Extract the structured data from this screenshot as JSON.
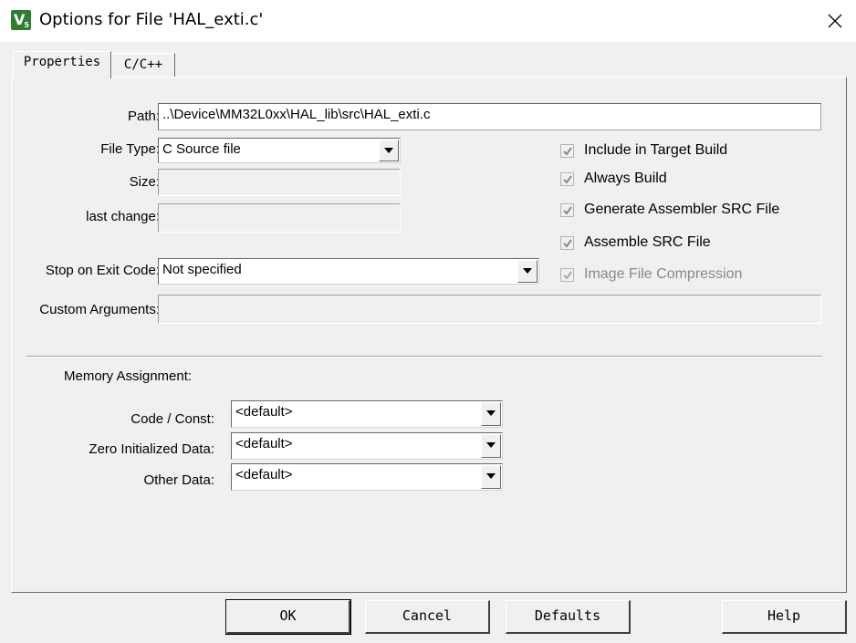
{
  "window": {
    "title": "Options for File 'HAL_exti.c'"
  },
  "tabs": [
    {
      "label": "Properties"
    },
    {
      "label": "C/C++"
    }
  ],
  "fields": {
    "path": {
      "label": "Path:",
      "value": "..\\Device\\MM32L0xx\\HAL_lib\\src\\HAL_exti.c"
    },
    "file_type": {
      "label": "File Type:",
      "value": "C Source file"
    },
    "size": {
      "label": "Size:",
      "value": ""
    },
    "last_change": {
      "label": "last change:",
      "value": ""
    },
    "stop_on_exit": {
      "label": "Stop on Exit Code:",
      "value": "Not specified"
    },
    "custom_args": {
      "label": "Custom Arguments:",
      "value": ""
    }
  },
  "checkboxes": [
    {
      "label": "Include in Target Build",
      "checked": true,
      "enabled": true
    },
    {
      "label": "Always Build",
      "checked": true,
      "enabled": true
    },
    {
      "label": "Generate Assembler SRC File",
      "checked": true,
      "enabled": true
    },
    {
      "label": "Assemble SRC File",
      "checked": true,
      "enabled": true
    },
    {
      "label": "Image File Compression",
      "checked": true,
      "enabled": false
    }
  ],
  "memory": {
    "heading": "Memory Assignment:",
    "code_const": {
      "label": "Code / Const:",
      "value": "<default>"
    },
    "zero_init": {
      "label": "Zero Initialized Data:",
      "value": "<default>"
    },
    "other_data": {
      "label": "Other Data:",
      "value": "<default>"
    }
  },
  "buttons": {
    "ok": "OK",
    "cancel": "Cancel",
    "defaults": "Defaults",
    "help": "Help"
  }
}
